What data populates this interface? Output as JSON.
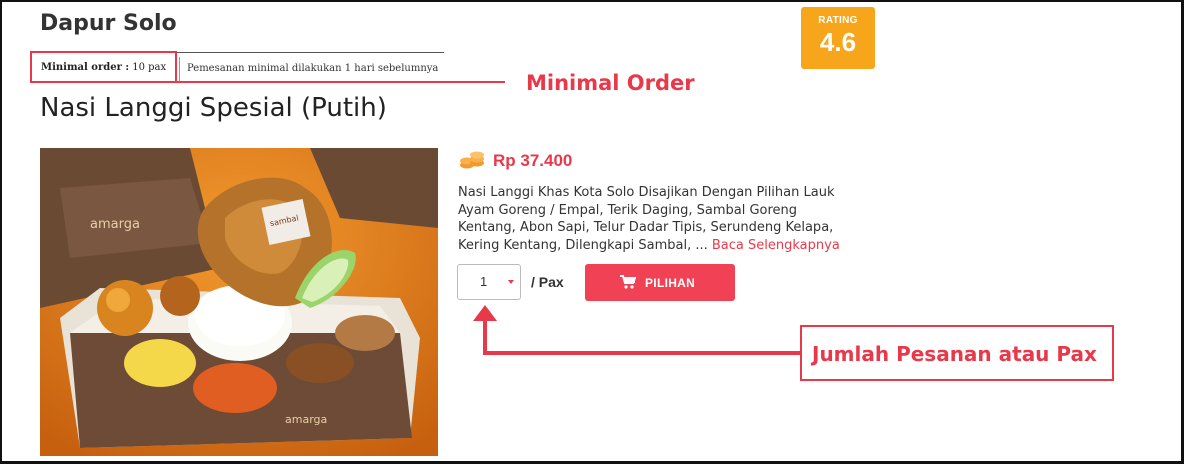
{
  "restaurant": {
    "name": "Dapur Solo"
  },
  "min_order": {
    "label": "Minimal order :",
    "value": "10 pax",
    "note": "Pemesanan minimal dilakukan 1 hari sebelumnya"
  },
  "rating": {
    "label": "RATING",
    "value": "4.6",
    "color": "#f7a51b"
  },
  "product": {
    "title": "Nasi Langgi Spesial (Putih)",
    "price": "Rp 37.400",
    "description": "Nasi Langgi Khas Kota Solo Disajikan Dengan Pilihan Lauk Ayam Goreng / Empal, Terik Daging, Sambal Goreng Kentang, Abon Sapi, Telur Dadar Tipis, Serundeng Kelapa, Kering Kentang, Dilengkapi Sambal, ...",
    "read_more": "Baca Selengkapnya",
    "photo_box_text": "amarga",
    "photo_sachet_text": "sambal"
  },
  "order": {
    "quantity": "1",
    "unit": "/ Pax",
    "button_label": "PILIHAN",
    "button_icon": "cart-icon"
  },
  "annotations": {
    "minimal_order": "Minimal Order",
    "quantity": "Jumlah Pesanan atau Pax"
  },
  "colors": {
    "accent": "#e8394a",
    "button": "#f04155",
    "rating_bg": "#f7a51b"
  }
}
